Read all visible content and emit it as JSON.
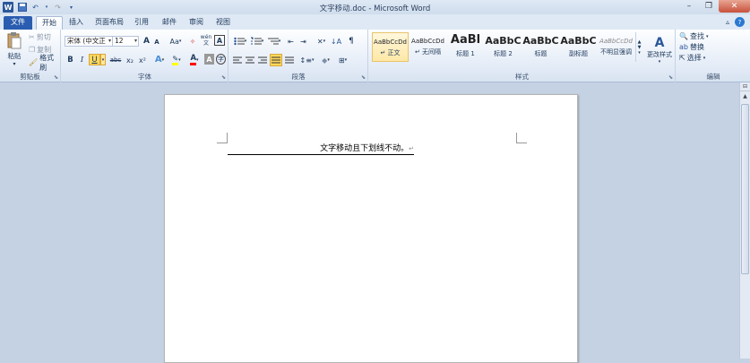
{
  "window": {
    "title": "文字移动.doc - Microsoft Word",
    "app_icon": "W"
  },
  "tabs": [
    "文件",
    "开始",
    "插入",
    "页面布局",
    "引用",
    "邮件",
    "审阅",
    "视图"
  ],
  "clipboard": {
    "paste": "粘贴",
    "cut": "剪切",
    "copy": "复制",
    "format_painter": "格式刷",
    "label": "剪贴板"
  },
  "font": {
    "name": "宋体 (中文正",
    "size": "12",
    "label": "字体",
    "bold": "B",
    "italic": "I",
    "underline": "U",
    "strike": "abc",
    "sub": "x₂",
    "sup": "x²",
    "case": "Aa",
    "grow": "A",
    "shrink": "A",
    "phonetic": "wén",
    "border": "A"
  },
  "paragraph": {
    "label": "段落"
  },
  "styles": {
    "label": "样式",
    "change_styles": "更改样式",
    "items": [
      {
        "sample": "AaBbCcDd",
        "name": "↵ 正文"
      },
      {
        "sample": "AaBbCcDd",
        "name": "↵ 无间隔"
      },
      {
        "sample": "AaBl",
        "name": "标题 1"
      },
      {
        "sample": "AaBbC",
        "name": "标题 2"
      },
      {
        "sample": "AaBbC",
        "name": "标题"
      },
      {
        "sample": "AaBbC",
        "name": "副标题"
      },
      {
        "sample": "AaBbCcDd",
        "name": "不明显强调"
      }
    ]
  },
  "editing": {
    "find": "查找",
    "replace": "替换",
    "select": "选择",
    "label": "编辑"
  },
  "document": {
    "text": "文字移动且下划线不动。",
    "return_mark": "↵"
  },
  "colors": {
    "accent": "#2b579a",
    "file_tab": "#2a5db0",
    "highlight": "#ffff00",
    "font_color": "#ff0000"
  }
}
